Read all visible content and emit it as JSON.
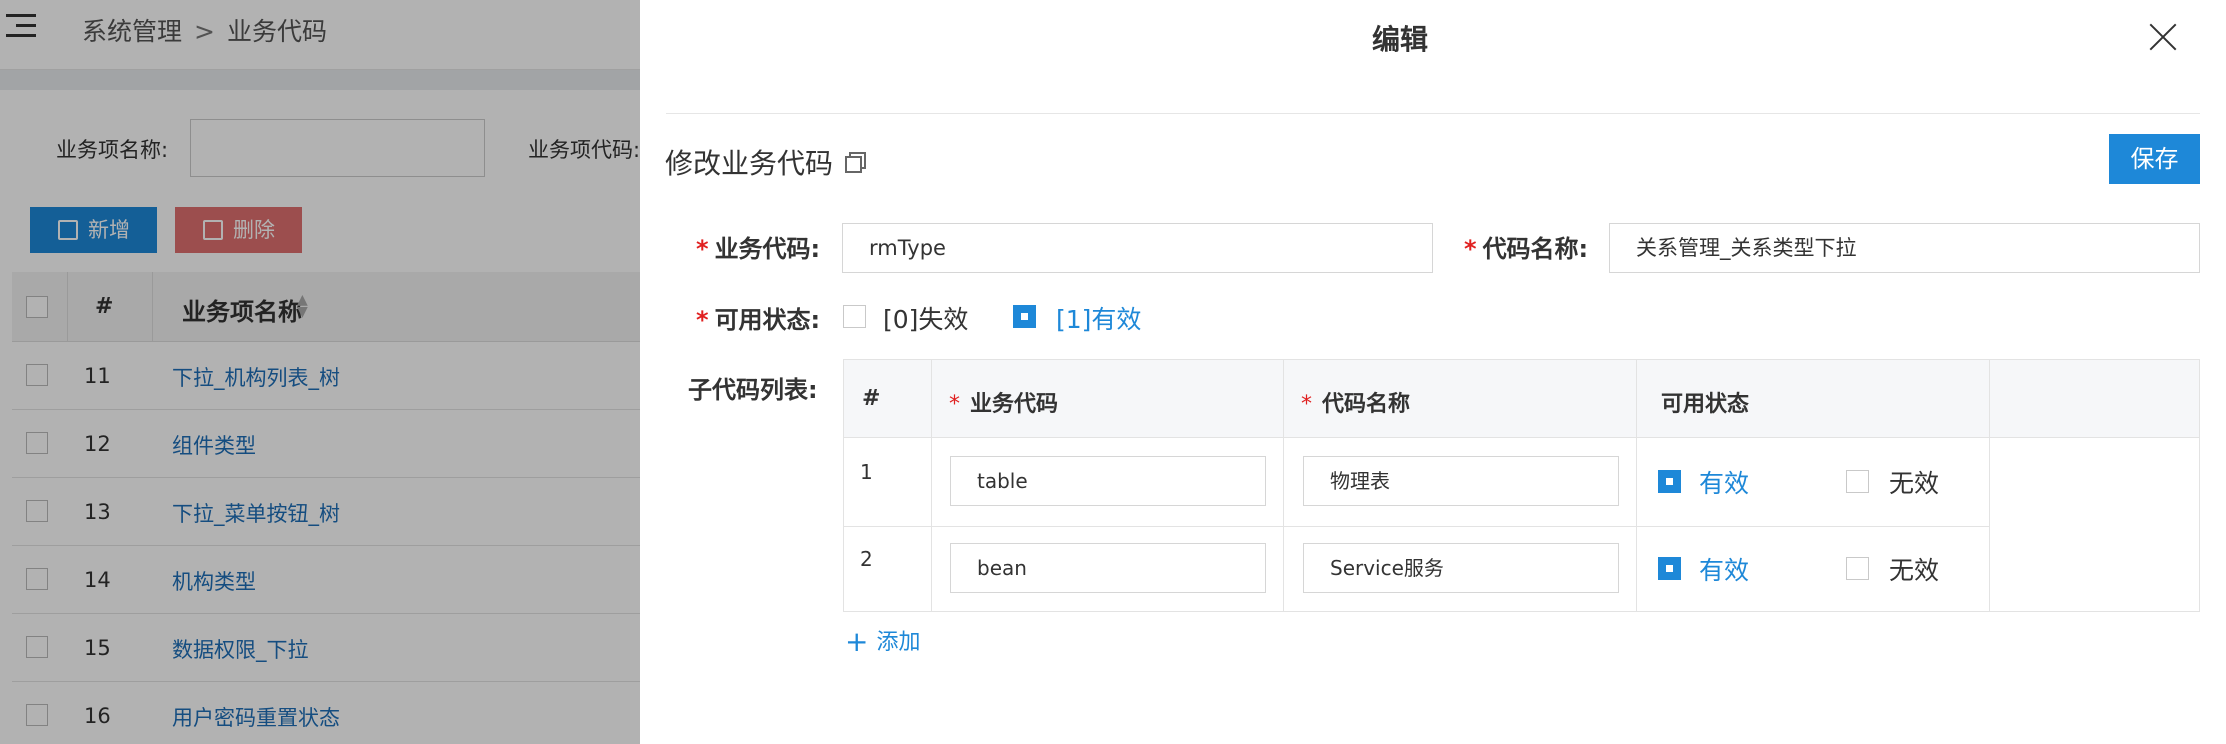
{
  "background": {
    "breadcrumb": [
      "系统管理",
      "业务代码"
    ],
    "breadcrumb_sep": ">",
    "search": {
      "name_label": "业务项名称:",
      "code_label": "业务项代码:"
    },
    "buttons": {
      "add": "新增",
      "delete": "删除"
    },
    "list": {
      "columns": [
        "#",
        "业务项名称"
      ],
      "rows": [
        {
          "num": "11",
          "name": "下拉_机构列表_树"
        },
        {
          "num": "12",
          "name": "组件类型"
        },
        {
          "num": "13",
          "name": "下拉_菜单按钮_树"
        },
        {
          "num": "14",
          "name": "机构类型"
        },
        {
          "num": "15",
          "name": "数据权限_下拉"
        },
        {
          "num": "16",
          "name": "用户密码重置状态"
        }
      ]
    }
  },
  "modal": {
    "title": "编辑",
    "section_title": "修改业务代码",
    "save_label": "保存",
    "fields": {
      "code_label": "业务代码:",
      "code_value": "rmType",
      "name_label": "代码名称:",
      "name_value": "关系管理_关系类型下拉",
      "status_label": "可用状态:",
      "status_options": [
        {
          "label": "[0]失效",
          "checked": false
        },
        {
          "label": "[1]有效",
          "checked": true
        }
      ],
      "sub_label": "子代码列表:"
    },
    "sub_table": {
      "columns": {
        "num": "#",
        "code": "业务代码",
        "name": "代码名称",
        "status": "可用状态"
      },
      "rows": [
        {
          "num": "1",
          "code": "table",
          "name": "物理表",
          "valid_label": "有效",
          "invalid_label": "无效",
          "valid": true
        },
        {
          "num": "2",
          "code": "bean",
          "name": "Service服务",
          "valid_label": "有效",
          "invalid_label": "无效",
          "valid": true
        }
      ]
    },
    "add_label": "添加"
  }
}
